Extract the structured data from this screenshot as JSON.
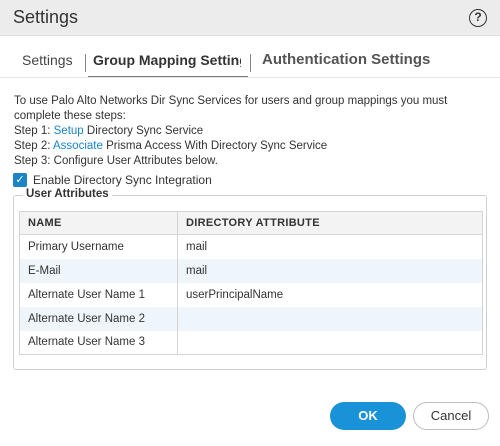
{
  "dialog": {
    "title": "Settings"
  },
  "tabs": [
    {
      "label": "Settings"
    },
    {
      "label": "Group Mapping Settings"
    },
    {
      "label": "Authentication  Settings"
    }
  ],
  "instructions": {
    "intro": "To use Palo Alto Networks Dir Sync Services for users and group mappings you must complete these steps:",
    "step1_prefix": "Step 1: ",
    "step1_link": "Setup",
    "step1_suffix": " Directory Sync Service",
    "step2_prefix": "Step 2: ",
    "step2_link": "Associate",
    "step2_suffix": " Prisma Access With Directory Sync Service",
    "step3": "Step 3: Configure User Attributes below."
  },
  "enable_checkbox": {
    "label": "Enable Directory Sync Integration",
    "checked": true
  },
  "user_attributes": {
    "legend": "User Attributes",
    "columns": [
      "NAME",
      "DIRECTORY ATTRIBUTE"
    ],
    "rows": [
      {
        "name": "Primary Username",
        "attribute": "mail"
      },
      {
        "name": "E-Mail",
        "attribute": "mail"
      },
      {
        "name": "Alternate User Name 1",
        "attribute": "userPrincipalName"
      },
      {
        "name": "Alternate User Name 2",
        "attribute": ""
      },
      {
        "name": "Alternate User Name 3",
        "attribute": ""
      }
    ]
  },
  "buttons": {
    "ok": "OK",
    "cancel": "Cancel"
  },
  "icons": {
    "help": "help-icon",
    "check": "checkmark-icon"
  },
  "colors": {
    "accent": "#1a84c6",
    "ok_button": "#1a92d8",
    "row_highlight": "#eef6fb"
  }
}
